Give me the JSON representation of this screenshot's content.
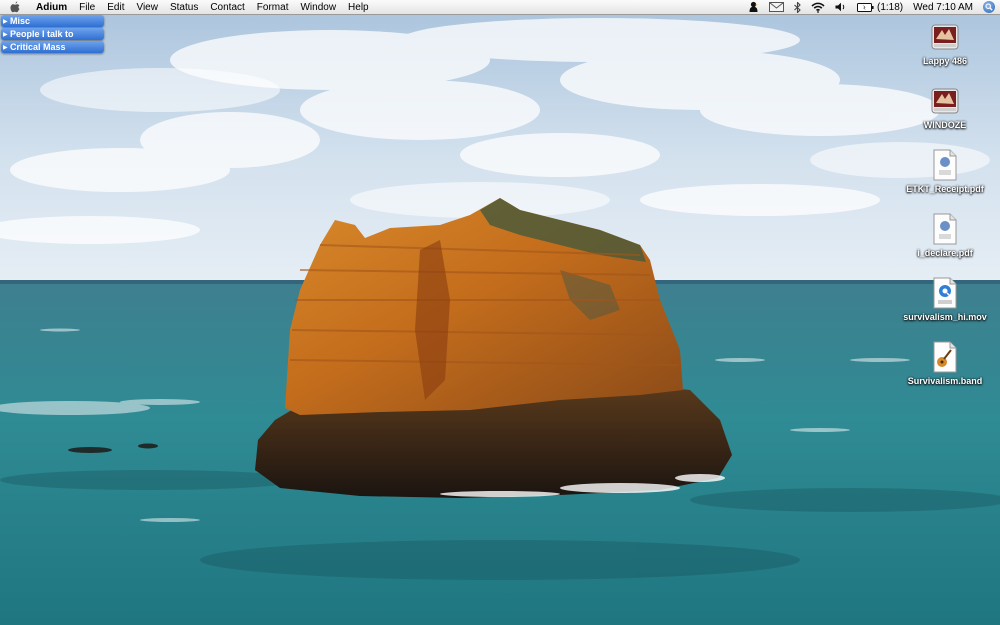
{
  "menubar": {
    "app_name": "Adium",
    "menus": [
      "File",
      "Edit",
      "View",
      "Status",
      "Contact",
      "Format",
      "Window",
      "Help"
    ],
    "battery_time": "(1:18)",
    "clock": "Wed 7:10 AM",
    "status_icons": [
      "adium-duck-icon",
      "mail-icon",
      "bluetooth-icon",
      "wifi-icon",
      "volume-icon",
      "battery-icon"
    ]
  },
  "contact_list": {
    "groups": [
      "Misc",
      "People I talk to",
      "Critical Mass"
    ]
  },
  "desktop": {
    "icons": [
      {
        "label": "Lappy 486",
        "type": "hard-drive"
      },
      {
        "label": "WINDOZE",
        "type": "hard-drive"
      },
      {
        "label": "ETKT_Receipt.pdf",
        "type": "pdf"
      },
      {
        "label": "i_declare.pdf",
        "type": "pdf"
      },
      {
        "label": "survivalism_hi.mov",
        "type": "movie"
      },
      {
        "label": "Survivalism.band",
        "type": "garageband"
      }
    ]
  },
  "colors": {
    "menubar": "#ececec",
    "group_header": "#3f7fdc",
    "sky": "#b9d0e6",
    "sea": "#2f8a93",
    "rock": "#c8751f"
  }
}
